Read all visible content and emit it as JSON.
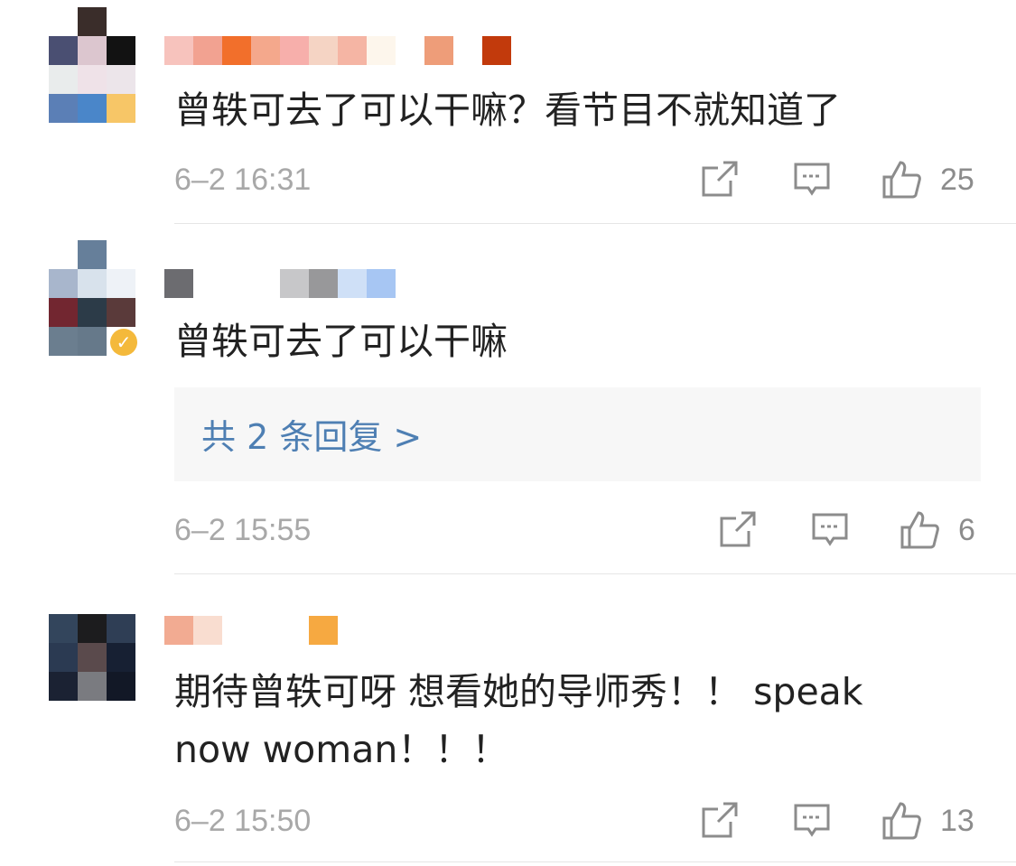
{
  "comments": [
    {
      "text": "曾轶可去了可以干嘛？看节目不就知道了",
      "time": "6–2 16:31",
      "likes": "25",
      "verified": true
    },
    {
      "text": "曾轶可去了可以干嘛",
      "time": "6–2 15:55",
      "likes": "6",
      "verified": true,
      "replies_label": "共 2 条回复 >"
    },
    {
      "text": "期待曾轶可呀 想看她的导师秀！！ speak now woman！！！",
      "time": "6–2 15:50",
      "likes": "13",
      "verified": false
    }
  ],
  "icons": {
    "share": "share-icon",
    "comment": "comment-icon",
    "like": "thumbs-up-icon",
    "verified": "verified-badge-icon"
  },
  "colors": {
    "link": "#4e7fb3",
    "meta": "#a8a8a8",
    "verified_badge": "#f4b93b"
  },
  "badge_glyph": "✓"
}
